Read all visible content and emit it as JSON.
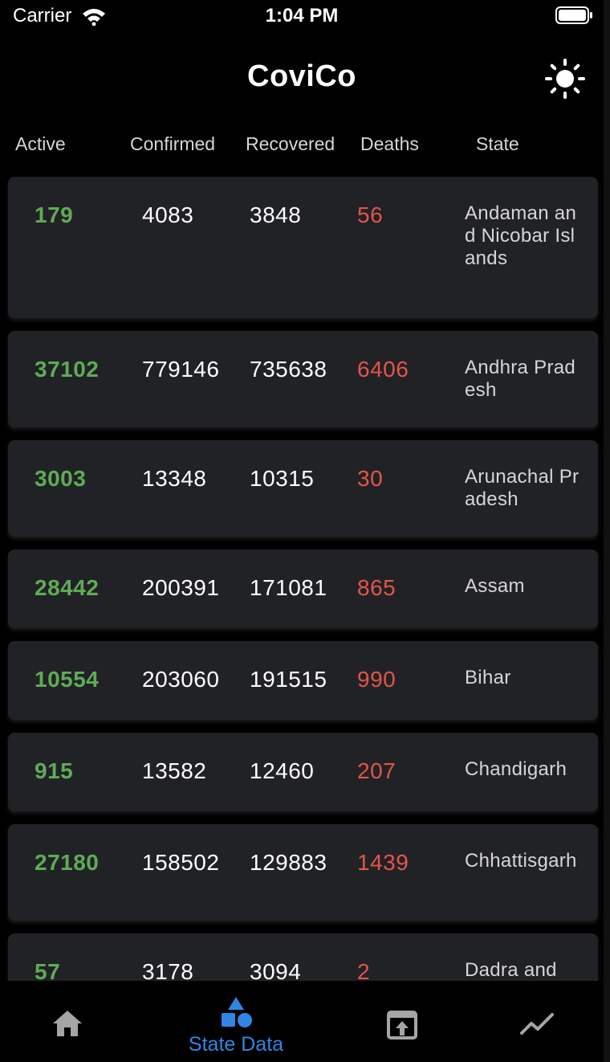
{
  "status_bar": {
    "carrier": "Carrier",
    "time": "1:04 PM"
  },
  "app_bar": {
    "title": "CoviCo",
    "theme_icon": "sun-icon"
  },
  "table_header": {
    "active": "Active",
    "confirmed": "Confirmed",
    "recovered": "Recovered",
    "deaths": "Deaths",
    "state": "State"
  },
  "rows": [
    {
      "active": "179",
      "confirmed": "4083",
      "recovered": "3848",
      "deaths": "56",
      "state": "Andaman and Nicobar Islands"
    },
    {
      "active": "37102",
      "confirmed": "779146",
      "recovered": "735638",
      "deaths": "6406",
      "state": "Andhra Pradesh"
    },
    {
      "active": "3003",
      "confirmed": "13348",
      "recovered": "10315",
      "deaths": "30",
      "state": "Arunachal Pradesh"
    },
    {
      "active": "28442",
      "confirmed": "200391",
      "recovered": "171081",
      "deaths": "865",
      "state": "Assam"
    },
    {
      "active": "10554",
      "confirmed": "203060",
      "recovered": "191515",
      "deaths": "990",
      "state": "Bihar"
    },
    {
      "active": "915",
      "confirmed": "13582",
      "recovered": "12460",
      "deaths": "207",
      "state": "Chandigarh"
    },
    {
      "active": "27180",
      "confirmed": "158502",
      "recovered": "129883",
      "deaths": "1439",
      "state": "Chhattisgarh"
    },
    {
      "active": "57",
      "confirmed": "3178",
      "recovered": "3094",
      "deaths": "2",
      "state": "Dadra and"
    }
  ],
  "tab_bar": {
    "active_tab": "State Data",
    "tabs": [
      {
        "icon": "home-icon",
        "label": ""
      },
      {
        "icon": "shapes-icon",
        "label": "State Data"
      },
      {
        "icon": "open-external-icon",
        "label": ""
      },
      {
        "icon": "trending-icon",
        "label": ""
      }
    ]
  },
  "colors": {
    "active_green": "#5fab57",
    "deaths_red": "#e2554a",
    "selected_tab_blue": "#2f86e6",
    "card_background": "#212226"
  }
}
